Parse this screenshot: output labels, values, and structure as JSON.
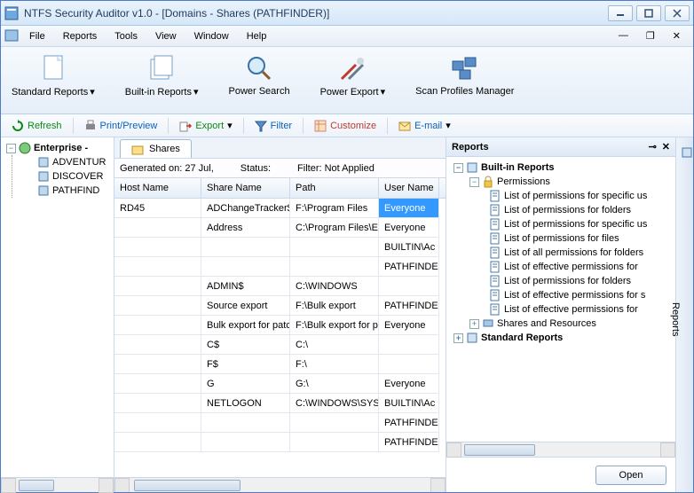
{
  "title": "NTFS Security Auditor v1.0 - [Domains - Shares (PATHFINDER)]",
  "menu": {
    "items": [
      "File",
      "Reports",
      "Tools",
      "View",
      "Window",
      "Help"
    ]
  },
  "ribbon": {
    "items": [
      {
        "label": "Standard Reports"
      },
      {
        "label": "Built-in Reports"
      },
      {
        "label": "Power Search"
      },
      {
        "label": "Power Export"
      },
      {
        "label": "Scan Profiles Manager"
      }
    ]
  },
  "toolbar": {
    "refresh": "Refresh",
    "print": "Print/Preview",
    "export": "Export",
    "filter": "Filter",
    "customize": "Customize",
    "email": "E-mail"
  },
  "tree": {
    "root": "Enterprise -",
    "children": [
      "ADVENTUR",
      "DISCOVER",
      "PATHFIND"
    ]
  },
  "tab": {
    "label": "Shares"
  },
  "info": {
    "generated": "Generated on: 27 Jul,",
    "status": "Status:",
    "filter": "Filter: Not Applied"
  },
  "grid": {
    "columns": [
      "Host Name",
      "Share Name",
      "Path",
      "User Name"
    ],
    "rows": [
      {
        "host": "RD45",
        "share": "ADChangeTracker$",
        "path": "F:\\Program Files",
        "user": "Everyone",
        "sel": true
      },
      {
        "host": "",
        "share": "Address",
        "path": "C:\\Program Files\\Exc",
        "user": "Everyone"
      },
      {
        "host": "",
        "share": "",
        "path": "",
        "user": "BUILTIN\\Ac"
      },
      {
        "host": "",
        "share": "",
        "path": "",
        "user": "PATHFINDE"
      },
      {
        "host": "",
        "share": "ADMIN$",
        "path": "C:\\WINDOWS",
        "user": ""
      },
      {
        "host": "",
        "share": "Source export",
        "path": "F:\\Bulk export",
        "user": "PATHFINDE"
      },
      {
        "host": "",
        "share": "Bulk export for patch",
        "path": "F:\\Bulk export for pa",
        "user": "Everyone"
      },
      {
        "host": "",
        "share": "C$",
        "path": "C:\\",
        "user": ""
      },
      {
        "host": "",
        "share": "F$",
        "path": "F:\\",
        "user": ""
      },
      {
        "host": "",
        "share": "G",
        "path": "G:\\",
        "user": "Everyone"
      },
      {
        "host": "",
        "share": "NETLOGON",
        "path": "C:\\WINDOWS\\SYSV",
        "user": "BUILTIN\\Ac"
      },
      {
        "host": "",
        "share": "",
        "path": "",
        "user": "PATHFINDE"
      },
      {
        "host": "",
        "share": "",
        "path": "",
        "user": "PATHFINDE"
      }
    ]
  },
  "reports": {
    "title": "Reports",
    "root": "Built-in Reports",
    "perm": "Permissions",
    "items": [
      "List of permissions for specific us",
      "List of permissions for folders",
      "List of permissions for specific us",
      "List of permissions for files",
      "List of all permissions for folders",
      "List of effective permissions for",
      "List of permissions for folders",
      "List of effective permissions for s",
      "List of effective permissions for"
    ],
    "shares": "Shares and Resources",
    "std": "Standard Reports",
    "open": "Open",
    "sideTab": "Reports"
  }
}
